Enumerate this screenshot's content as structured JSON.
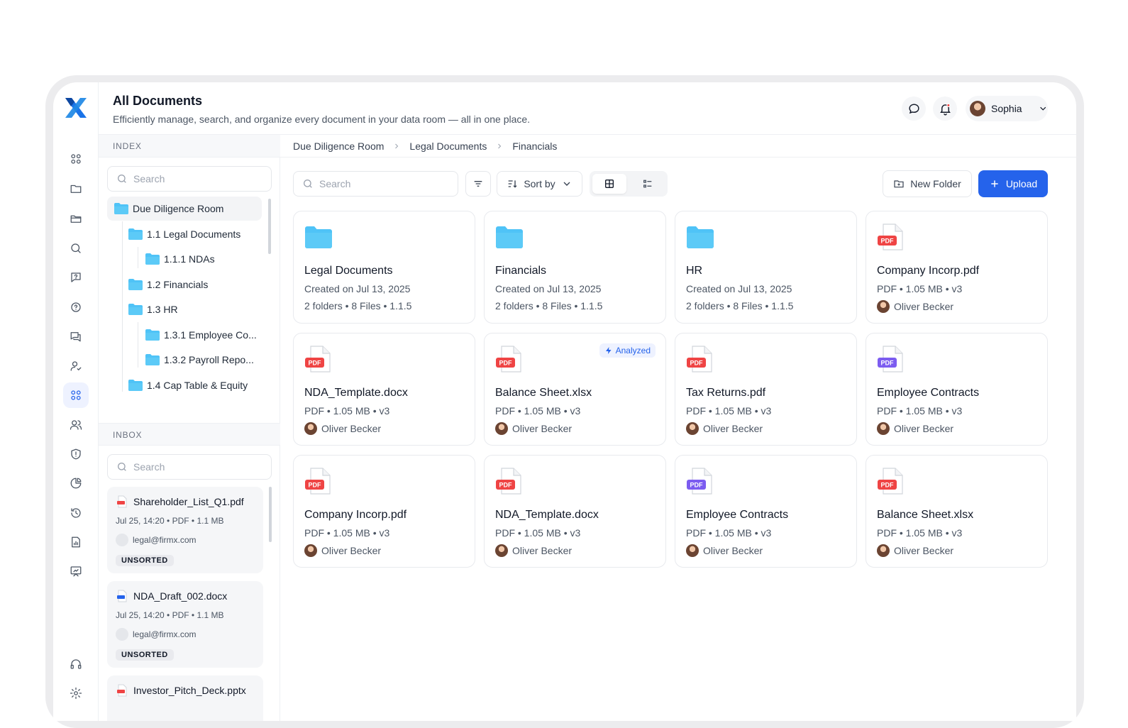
{
  "header": {
    "title": "All Documents",
    "subtitle": "Efficiently manage, search, and organize every document in your data room — all in one place.",
    "user_name": "Sophia"
  },
  "rail": {
    "icons": [
      "grid-icon",
      "folder-icon",
      "folders-icon",
      "search-icon",
      "question-chat-icon",
      "help-icon",
      "chat-icon",
      "user-check-icon",
      "apps-icon",
      "users-icon",
      "shield-icon",
      "pie-chart-icon",
      "history-icon",
      "report-icon",
      "presentation-icon",
      "headset-icon",
      "gear-icon"
    ],
    "active": "apps-icon"
  },
  "index": {
    "heading": "INDEX",
    "search_placeholder": "Search",
    "tree": [
      {
        "label": "Due Diligence Room",
        "level": 0
      },
      {
        "label": "1.1 Legal Documents",
        "level": 1
      },
      {
        "label": "1.1.1 NDAs",
        "level": 2
      },
      {
        "label": "1.2 Financials",
        "level": 1
      },
      {
        "label": "1.3 HR",
        "level": 1
      },
      {
        "label": "1.3.1 Employee Co...",
        "level": 2
      },
      {
        "label": "1.3.2 Payroll Repo...",
        "level": 2
      },
      {
        "label": "1.4 Cap Table & Equity",
        "level": 1
      }
    ]
  },
  "inbox": {
    "heading": "INBOX",
    "search_placeholder": "Search",
    "items": [
      {
        "name": "Shareholder_List_Q1.pdf",
        "meta": "Jul 25, 14:20  •  PDF  •  1.1 MB",
        "email": "legal@firmx.com",
        "badge": "UNSORTED",
        "file_type": "pdf"
      },
      {
        "name": "NDA_Draft_002.docx",
        "meta": "Jul 25, 14:20  •  PDF  •  1.1 MB",
        "email": "legal@firmx.com",
        "badge": "UNSORTED",
        "file_type": "doc"
      },
      {
        "name": "Investor_Pitch_Deck.pptx",
        "meta": "",
        "email": "",
        "badge": "",
        "file_type": "ppt"
      }
    ]
  },
  "breadcrumb": [
    "Due Diligence Room",
    "Legal Documents",
    "Financials"
  ],
  "toolbar": {
    "search_placeholder": "Search",
    "sort_label": "Sort by",
    "new_folder_label": "New Folder",
    "upload_label": "Upload"
  },
  "cards": [
    {
      "kind": "folder",
      "name": "Legal Documents",
      "line1": "Created on Jul 13, 2025",
      "line2": "2 folders  •  8 Files  •  1.1.5"
    },
    {
      "kind": "folder",
      "name": "Financials",
      "line1": "Created on Jul 13, 2025",
      "line2": "2 folders  •  8 Files  •  1.1.5"
    },
    {
      "kind": "folder",
      "name": "HR",
      "line1": "Created on Jul 13, 2025",
      "line2": "2 folders  •  8 Files  •  1.1.5"
    },
    {
      "kind": "pdf",
      "name": "Company Incorp.pdf",
      "line1": "PDF  •  1.05 MB  •  v3",
      "line2": "Oliver Becker"
    },
    {
      "kind": "pdf",
      "name": "NDA_Template.docx",
      "line1": "PDF  •  1.05 MB  •  v3",
      "line2": "Oliver Becker"
    },
    {
      "kind": "pdf",
      "name": "Balance Sheet.xlsx",
      "line1": "PDF  •  1.05 MB  •  v3",
      "line2": "Oliver Becker",
      "badge": "Analyzed"
    },
    {
      "kind": "pdf",
      "name": "Tax Returns.pdf",
      "line1": "PDF  •  1.05 MB  •  v3",
      "line2": "Oliver Becker"
    },
    {
      "kind": "pdf-purple",
      "name": "Employee Contracts",
      "line1": "PDF  •  1.05 MB  •  v3",
      "line2": "Oliver Becker"
    },
    {
      "kind": "pdf",
      "name": "Company Incorp.pdf",
      "line1": "PDF  •  1.05 MB  •  v3",
      "line2": "Oliver Becker"
    },
    {
      "kind": "pdf",
      "name": "NDA_Template.docx",
      "line1": "PDF  •  1.05 MB  •  v3",
      "line2": "Oliver Becker"
    },
    {
      "kind": "pdf-purple",
      "name": "Employee Contracts",
      "line1": "PDF  •  1.05 MB  •  v3",
      "line2": "Oliver Becker"
    },
    {
      "kind": "pdf",
      "name": "Balance Sheet.xlsx",
      "line1": "PDF  •  1.05 MB  •  v3",
      "line2": "Oliver Becker"
    }
  ],
  "file_badge_text": "PDF",
  "colors": {
    "accent": "#2563eb",
    "folder": "#4fc3f7",
    "pdf_red": "#ef4444",
    "pdf_purple": "#7c5cf0",
    "doc_blue": "#2563eb"
  }
}
